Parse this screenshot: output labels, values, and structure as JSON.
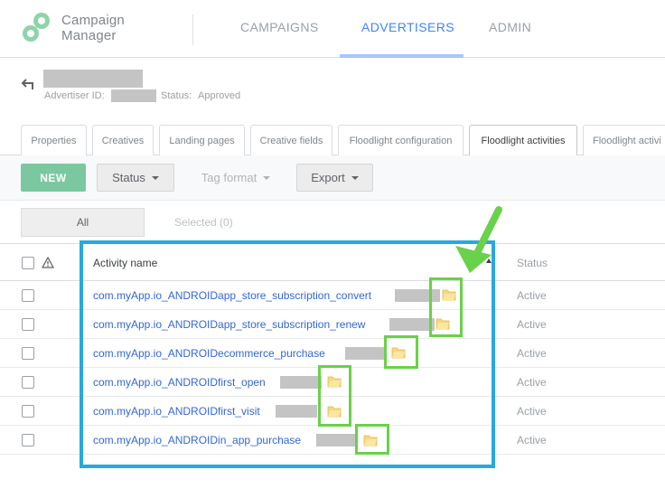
{
  "app": {
    "brand_line1": "Campaign",
    "brand_line2": "Manager"
  },
  "nav": {
    "tabs": [
      {
        "label": "CAMPAIGNS",
        "active": false
      },
      {
        "label": "ADVERTISERS",
        "active": true
      },
      {
        "label": "ADMIN",
        "active": false
      }
    ]
  },
  "advertiser": {
    "id_label": "Advertiser ID:",
    "status_label": "Status:",
    "status_value": "Approved"
  },
  "subtabs": [
    {
      "label": "Properties"
    },
    {
      "label": "Creatives"
    },
    {
      "label": "Landing pages"
    },
    {
      "label": "Creative fields"
    },
    {
      "label": "Floodlight configuration"
    },
    {
      "label": "Floodlight activities",
      "active": true
    },
    {
      "label": "Floodlight activi"
    }
  ],
  "toolbar": {
    "new_label": "NEW",
    "status_label": "Status",
    "tag_format_label": "Tag format",
    "export_label": "Export"
  },
  "filters": {
    "all_label": "All",
    "selected_label": "Selected (0)"
  },
  "table": {
    "columns": {
      "name": "Activity name",
      "status": "Status"
    },
    "rows": [
      {
        "name": "com.myApp.io_ANDROIDapp_store_subscription_convert",
        "status": "Active"
      },
      {
        "name": "com.myApp.io_ANDROIDapp_store_subscription_renew",
        "status": "Active"
      },
      {
        "name": "com.myApp.io_ANDROIDecommerce_purchase",
        "status": "Active"
      },
      {
        "name": "com.myApp.io_ANDROIDfirst_open",
        "status": "Active"
      },
      {
        "name": "com.myApp.io_ANDROIDfirst_visit",
        "status": "Active"
      },
      {
        "name": "com.myApp.io_ANDROIDin_app_purchase",
        "status": "Active"
      }
    ]
  },
  "colors": {
    "accent_blue": "#4285f4",
    "link": "#3367d6",
    "new_button": "#7bc8a0",
    "annotation_blue": "#29a8e0",
    "annotation_green": "#6ad14a"
  },
  "icons": {
    "back": "arrow-back-icon",
    "warning": "warning-icon",
    "folder": "folder-icon",
    "sort": "sort-arrow-icon"
  }
}
